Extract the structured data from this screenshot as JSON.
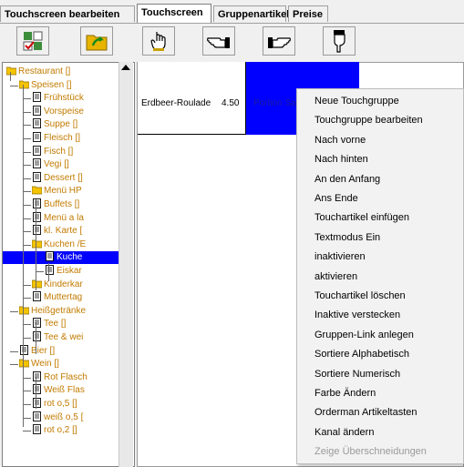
{
  "tabs": [
    {
      "label": "Touchscreen bearbeiten",
      "active": false
    },
    {
      "label": "Touchscreen",
      "active": true
    },
    {
      "label": "Gruppenartikel",
      "active": false
    },
    {
      "label": "Preise",
      "active": false
    }
  ],
  "toolbar": {
    "buttons": [
      {
        "icon": "grid-check-icon"
      },
      {
        "icon": "folder-arrow-icon"
      },
      {
        "icon": "hand-press-icon"
      },
      {
        "icon": "hand-point-left-icon"
      },
      {
        "icon": "hand-point-right-icon"
      },
      {
        "icon": "hand-point-down-icon"
      }
    ]
  },
  "tree": {
    "items": [
      {
        "label": "Restaurant []",
        "type": "folder"
      },
      {
        "label": "Speisen []",
        "type": "folder"
      },
      {
        "label": "Frühstück",
        "type": "doc"
      },
      {
        "label": "Vorspeise",
        "type": "doc"
      },
      {
        "label": "Suppe []",
        "type": "doc"
      },
      {
        "label": "Fleisch []",
        "type": "doc"
      },
      {
        "label": "Fisch []",
        "type": "doc"
      },
      {
        "label": "Vegi []",
        "type": "doc"
      },
      {
        "label": "Dessert []",
        "type": "doc"
      },
      {
        "label": "Menü HP",
        "type": "folder"
      },
      {
        "label": "Buffets []",
        "type": "doc"
      },
      {
        "label": "Menü a la",
        "type": "doc"
      },
      {
        "label": "kl. Karte [",
        "type": "doc"
      },
      {
        "label": "Kuchen /E",
        "type": "folder"
      },
      {
        "label": "Kuche",
        "type": "doc",
        "selected": true
      },
      {
        "label": "Eiskar",
        "type": "doc"
      },
      {
        "label": "Kinderkar",
        "type": "folder"
      },
      {
        "label": "Muttertag",
        "type": "doc"
      },
      {
        "label": "Heißgetränke",
        "type": "folder"
      },
      {
        "label": "Tee []",
        "type": "doc"
      },
      {
        "label": "Tee & wei",
        "type": "doc"
      },
      {
        "label": "Bier []",
        "type": "doc"
      },
      {
        "label": "Wein []",
        "type": "folder"
      },
      {
        "label": "Rot Flasch",
        "type": "doc"
      },
      {
        "label": "Weiß Flas",
        "type": "doc"
      },
      {
        "label": "rot o,5 []",
        "type": "doc"
      },
      {
        "label": "weiß o,5 [",
        "type": "doc"
      },
      {
        "label": "rot o,2 []",
        "type": "doc"
      }
    ]
  },
  "grid": {
    "cell1": {
      "name": "Erdbeer-Roulade",
      "price": "4.50"
    },
    "cell2": {
      "name": "Portion Sa",
      "color": "#0000ff"
    }
  },
  "context_menu": {
    "items": [
      {
        "label": "Neue Touchgruppe",
        "enabled": true
      },
      {
        "label": "Touchgruppe bearbeiten",
        "enabled": true
      },
      {
        "label": "Nach vorne",
        "enabled": true
      },
      {
        "label": "Nach hinten",
        "enabled": true
      },
      {
        "label": "An den Anfang",
        "enabled": true
      },
      {
        "label": "Ans Ende",
        "enabled": true
      },
      {
        "label": "Touchartikel einfügen",
        "enabled": true
      },
      {
        "label": "Textmodus Ein",
        "enabled": true
      },
      {
        "label": "inaktivieren",
        "enabled": true
      },
      {
        "label": "aktivieren",
        "enabled": true
      },
      {
        "label": "Touchartikel löschen",
        "enabled": true
      },
      {
        "label": "Inaktive verstecken",
        "enabled": true
      },
      {
        "label": "Gruppen-Link anlegen",
        "enabled": true
      },
      {
        "label": "Sortiere Alphabetisch",
        "enabled": true
      },
      {
        "label": "Sortiere Numerisch",
        "enabled": true
      },
      {
        "label": "Farbe Ändern",
        "enabled": true
      },
      {
        "label": "Orderman Artikeltasten",
        "enabled": true
      },
      {
        "label": "Kanal ändern",
        "enabled": true
      },
      {
        "label": "Zeige Überschneidungen",
        "enabled": false
      }
    ]
  }
}
